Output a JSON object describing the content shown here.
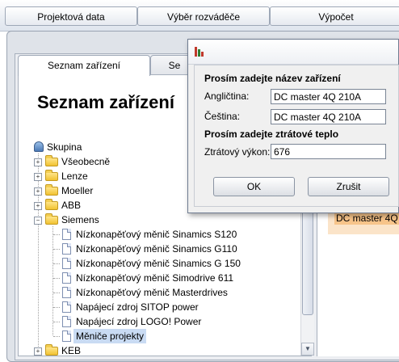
{
  "top_tabs": [
    {
      "label": "Projektová data"
    },
    {
      "label": "Výběr rozváděče"
    },
    {
      "label": "Výpočet"
    }
  ],
  "inner_tabs": [
    {
      "label": "Seznam zařízení"
    },
    {
      "label": "Se"
    }
  ],
  "page_title": "Seznam zařízení",
  "tree": {
    "root": "Skupina",
    "items": [
      {
        "label": "Všeobecně"
      },
      {
        "label": "Lenze"
      },
      {
        "label": "Moeller"
      },
      {
        "label": "ABB"
      },
      {
        "label": "Siemens"
      },
      {
        "label": "Nízkonapěťový měnič Sinamics S120"
      },
      {
        "label": "Nízkonapěťový měnič Sinamics G110"
      },
      {
        "label": "Nízkonapěťový měnič Sinamics G 150"
      },
      {
        "label": "Nízkonapěťový měnič Simodrive 611"
      },
      {
        "label": "Nízkonapěťový měnič Masterdrives"
      },
      {
        "label": "Napájecí zdroj SITOP power"
      },
      {
        "label": "Napájecí zdroj LOGO! Power"
      },
      {
        "label": "Měniče projekty"
      },
      {
        "label": "KEB"
      }
    ]
  },
  "right_panel": {
    "selected_item": "DC master 4Q"
  },
  "dialog": {
    "name_heading": "Prosím zadejte název zařízení",
    "english_label": "Angličtina:",
    "english_value": "DC master 4Q 210A",
    "czech_label": "Čeština:",
    "czech_value": "DC master 4Q 210A",
    "loss_heading": "Prosím zadejte ztrátové teplo",
    "loss_label": "Ztrátový výkon:",
    "loss_value": "676",
    "ok_label": "OK",
    "cancel_label": "Zrušit"
  }
}
